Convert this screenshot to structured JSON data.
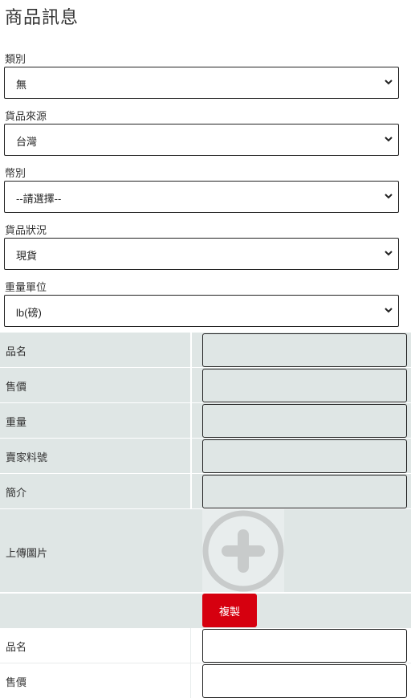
{
  "page": {
    "title": "商品訊息"
  },
  "selects": [
    {
      "label": "類別",
      "value": "無"
    },
    {
      "label": "貨品來源",
      "value": "台灣"
    },
    {
      "label": "幣別",
      "value": "--請選擇--"
    },
    {
      "label": "貨品狀況",
      "value": "現貨"
    },
    {
      "label": "重量單位",
      "value": "lb(磅)"
    }
  ],
  "item_form": {
    "rows": [
      "品名",
      "售價",
      "重量",
      "賣家料號",
      "簡介"
    ],
    "upload_label": "上傳圖片",
    "upload_icon": "plus-circle-icon",
    "copy_button": "複製"
  },
  "second_item_form": {
    "rows": [
      "品名",
      "售價"
    ]
  },
  "colors": {
    "row_background": "#dfe6e5",
    "copy_button": "#d6000f"
  }
}
